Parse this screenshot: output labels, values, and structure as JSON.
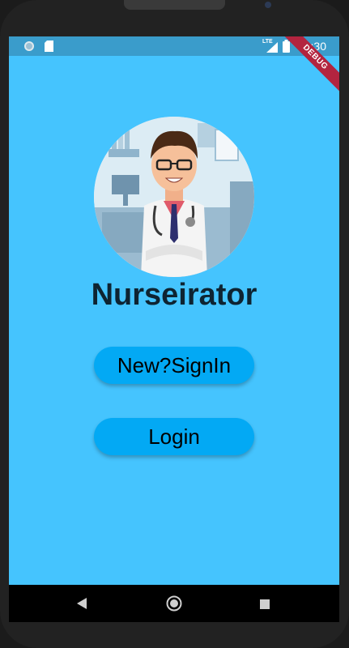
{
  "status_bar": {
    "time": "11:30",
    "network": "LTE",
    "debug_label": "DEBUG"
  },
  "app": {
    "title": "Nurseirator",
    "buttons": {
      "signin_label": "New?SignIn",
      "login_label": "Login"
    }
  },
  "icons": [
    "sync-icon",
    "sd-card-icon",
    "signal-icon",
    "battery-icon",
    "back-icon",
    "home-icon",
    "recents-icon",
    "doctor-avatar-icon"
  ],
  "colors": {
    "background": "#45c4fe",
    "status_bar": "#3a9ccb",
    "button": "#03a9f4",
    "title_text": "#0e2432"
  }
}
